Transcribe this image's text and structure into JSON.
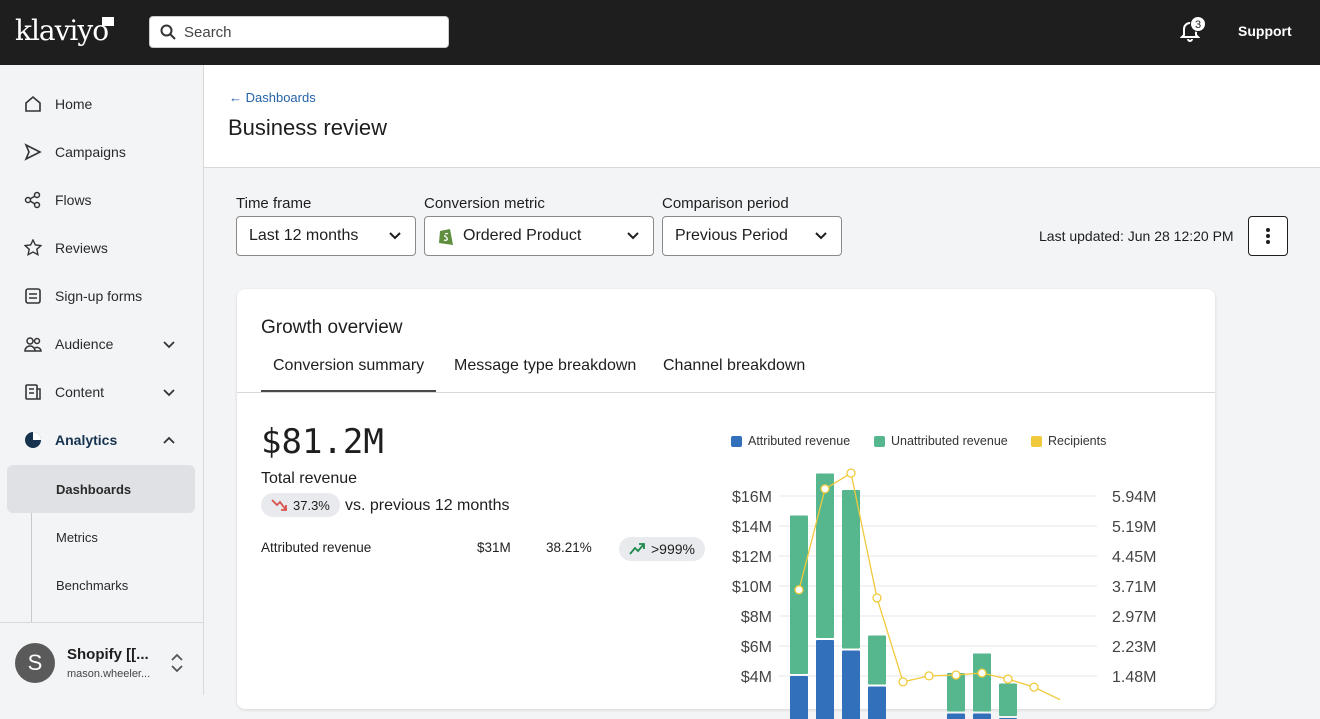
{
  "header": {
    "logo": "klaviyo",
    "search_placeholder": "Search",
    "notifications": "3",
    "support": "Support"
  },
  "sidebar": {
    "items": [
      {
        "label": "Home"
      },
      {
        "label": "Campaigns"
      },
      {
        "label": "Flows"
      },
      {
        "label": "Reviews"
      },
      {
        "label": "Sign-up forms"
      },
      {
        "label": "Audience"
      },
      {
        "label": "Content"
      },
      {
        "label": "Analytics"
      }
    ],
    "analytics_sub": [
      {
        "label": "Dashboards"
      },
      {
        "label": "Metrics"
      },
      {
        "label": "Benchmarks"
      }
    ],
    "account": {
      "initial": "S",
      "name": "Shopify [[...",
      "email": "mason.wheeler..."
    }
  },
  "page": {
    "breadcrumb": "Dashboards",
    "title": "Business review"
  },
  "filters": {
    "time_frame_label": "Time frame",
    "time_frame": "Last 12 months",
    "conversion_label": "Conversion metric",
    "conversion": "Ordered Product",
    "comparison_label": "Comparison period",
    "comparison": "Previous Period",
    "last_updated": "Last updated: Jun 28 12:20 PM"
  },
  "card": {
    "title": "Growth overview",
    "tabs": [
      "Conversion summary",
      "Message type breakdown",
      "Channel breakdown"
    ],
    "total_value": "$81.2M",
    "total_label": "Total revenue",
    "change": "37.3%",
    "change_text": "vs. previous 12 months",
    "row": {
      "label": "Attributed revenue",
      "value": "$31M",
      "share": "38.21%",
      "change": ">999%"
    }
  },
  "colors": {
    "attributed": "#3370bc",
    "unattributed": "#56b68e",
    "recipients": "#f1c93c",
    "down": "#d9534f",
    "up": "#1e8a4c"
  },
  "chart_data": {
    "type": "bar",
    "legend": [
      "Attributed revenue",
      "Unattributed revenue",
      "Recipients"
    ],
    "legend_position": "top",
    "y_left_ticks": [
      "$16M",
      "$14M",
      "$12M",
      "$10M",
      "$8M",
      "$6M",
      "$4M"
    ],
    "y_right_ticks": [
      "5.94M",
      "5.19M",
      "4.45M",
      "3.71M",
      "2.97M",
      "2.23M",
      "1.48M"
    ],
    "y_left_range": [
      0,
      18
    ],
    "y_right_range": [
      0,
      6.68
    ],
    "series": [
      {
        "name": "Attributed revenue",
        "unit": "$M",
        "values": [
          4.0,
          6.4,
          5.7,
          3.3,
          0,
          0,
          1.5,
          1.5,
          1.2
        ]
      },
      {
        "name": "Unattributed revenue",
        "unit": "$M",
        "values": [
          10.7,
          11.1,
          10.7,
          3.4,
          0,
          0,
          2.7,
          4.0,
          2.3
        ]
      },
      {
        "name": "Recipients",
        "unit": "M",
        "values": [
          3.62,
          6.12,
          6.51,
          3.42,
          1.34,
          1.49,
          1.51,
          1.56,
          1.41,
          1.21,
          0.9
        ]
      }
    ]
  }
}
